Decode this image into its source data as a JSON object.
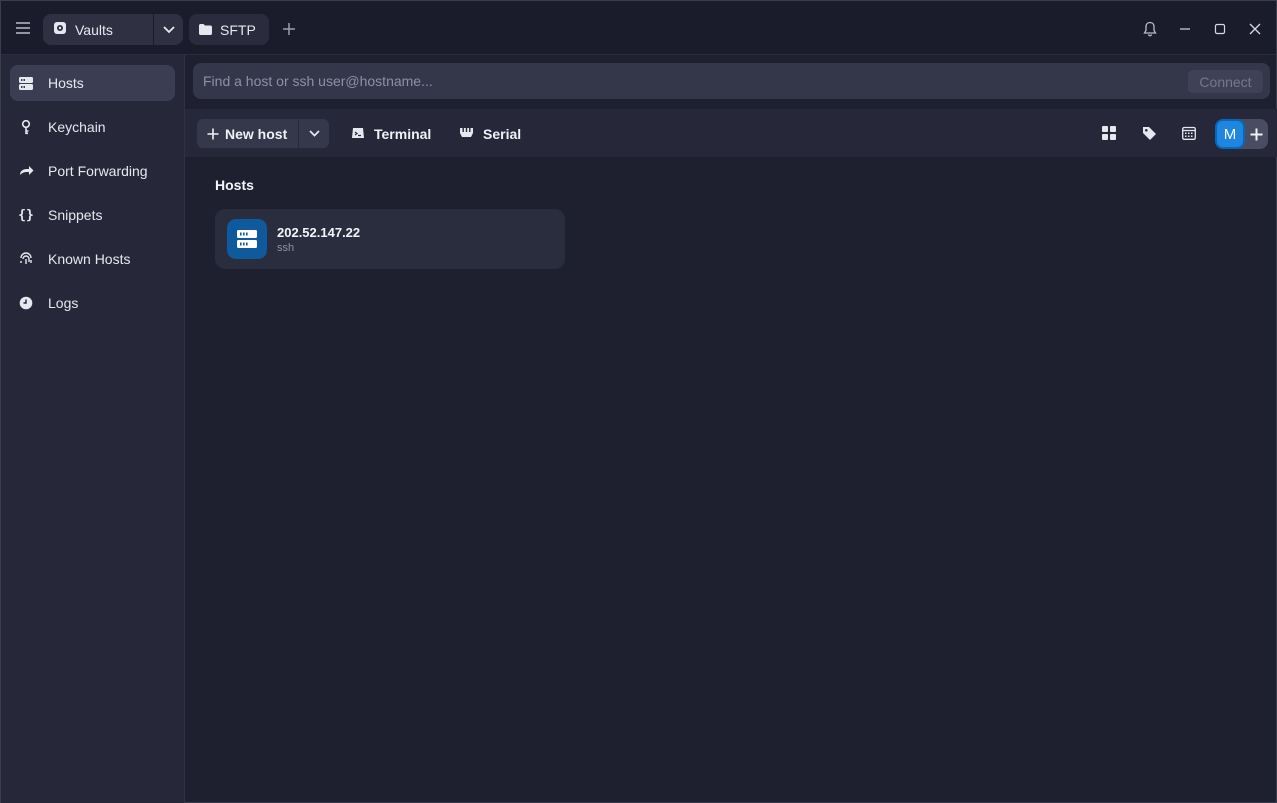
{
  "titlebar": {
    "vault_label": "Vaults",
    "sftp_label": "SFTP"
  },
  "sidebar": {
    "items": [
      {
        "label": "Hosts",
        "icon": "hosts-icon",
        "active": true
      },
      {
        "label": "Keychain",
        "icon": "key-icon",
        "active": false
      },
      {
        "label": "Port Forwarding",
        "icon": "port-forward-icon",
        "active": false
      },
      {
        "label": "Snippets",
        "icon": "braces-icon",
        "active": false
      },
      {
        "label": "Known Hosts",
        "icon": "fingerprint-icon",
        "active": false
      },
      {
        "label": "Logs",
        "icon": "clock-icon",
        "active": false
      }
    ]
  },
  "search": {
    "placeholder": "Find a host or ssh user@hostname...",
    "connect_label": "Connect"
  },
  "toolbar": {
    "new_host_label": "New host",
    "terminal_label": "Terminal",
    "serial_label": "Serial",
    "avatar_initial": "M"
  },
  "main": {
    "section_title": "Hosts",
    "hosts": [
      {
        "name": "202.52.147.22",
        "type": "ssh"
      }
    ]
  },
  "colors": {
    "accent": "#1c86e0",
    "host_icon_bg": "#0e5a9c",
    "background": "#1e2030",
    "sidebar": "#262839"
  }
}
